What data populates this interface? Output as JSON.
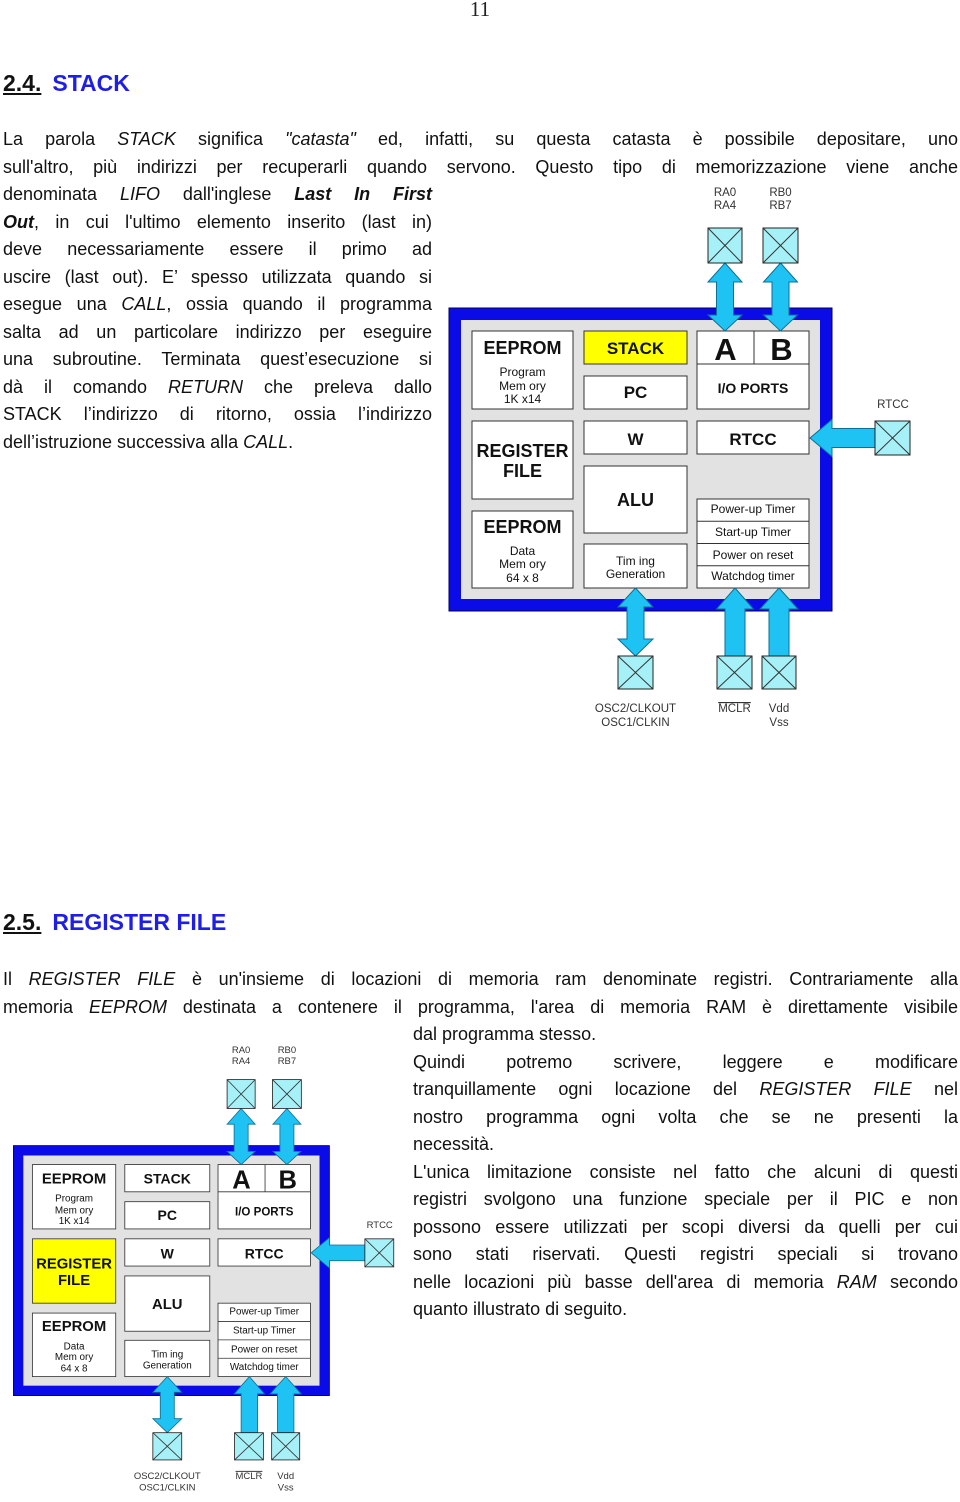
{
  "page_number": "11",
  "colors": {
    "heading_blue": "#1e1ee6",
    "chip_border": "#0b0be8",
    "chip_inner": "#e2e2e2",
    "arrow": "#1ec3f4",
    "pin_fill": "#a6f1f7",
    "highlight": "#ffff00"
  },
  "section_2_4": {
    "number": "2.4.",
    "title": "STACK",
    "lines": [
      {
        "runs": [
          {
            "t": "La parola "
          },
          {
            "t": "STACK",
            "s": "i"
          },
          {
            "t": " significa "
          },
          {
            "t": "\"catasta\"",
            "s": "i"
          },
          {
            "t": " ed, infatti, su questa catasta è possibile depositare,   uno"
          }
        ]
      },
      {
        "runs": [
          {
            "t": "sull'altro, più   indirizzi per recuperarli quando servono. Questo tipo di memorizzazione viene anche"
          }
        ]
      },
      {
        "runs": [
          {
            "t": "denominata "
          },
          {
            "t": "LIFO",
            "s": "i"
          },
          {
            "t": " dall'inglese "
          },
          {
            "t": "Last In First",
            "s": "bi"
          }
        ]
      },
      {
        "runs": [
          {
            "t": "Out",
            "s": "bi"
          },
          {
            "t": ", in cui l'ultimo elemento inserito (last in)"
          }
        ]
      },
      {
        "runs": [
          {
            "t": "deve necessariamente essere il primo ad"
          }
        ]
      },
      {
        "runs": [
          {
            "t": "uscire (last out). E’ spesso utilizzata quando si"
          }
        ]
      },
      {
        "runs": [
          {
            "t": "esegue una "
          },
          {
            "t": "CALL",
            "s": "i"
          },
          {
            "t": ", ossia quando il programma"
          }
        ]
      },
      {
        "runs": [
          {
            "t": "salta ad un particolare indirizzo per eseguire"
          }
        ]
      },
      {
        "runs": [
          {
            "t": "una subroutine. Terminata quest’esecuzione si"
          }
        ]
      },
      {
        "runs": [
          {
            "t": "dà il comando "
          },
          {
            "t": "RETURN",
            "s": "i"
          },
          {
            "t": " che preleva dallo"
          }
        ]
      },
      {
        "runs": [
          {
            "t": "STACK l’indirizzo di ritorno, ossia l’indirizzo"
          }
        ]
      },
      {
        "runs": [
          {
            "t": "dell’istruzione successiva alla "
          },
          {
            "t": "CALL",
            "s": "i"
          },
          {
            "t": "."
          }
        ]
      }
    ]
  },
  "section_2_5": {
    "number": "2.5.",
    "title": "REGISTER FILE",
    "lines": [
      {
        "runs": [
          {
            "t": "Il "
          },
          {
            "t": "REGISTER FILE",
            "s": "i"
          },
          {
            "t": " è un'insieme di locazioni di memoria ram denominate registri. Contrariamente alla"
          }
        ]
      },
      {
        "runs": [
          {
            "t": "memoria "
          },
          {
            "t": "EEPROM",
            "s": "i"
          },
          {
            "t": " destinata a contenere il programma, l'area di memoria RAM è direttamente visibile"
          }
        ]
      },
      {
        "runs": [
          {
            "t": "dal programma stesso."
          }
        ]
      },
      {
        "runs": [
          {
            "t": "Quindi potremo scrivere, leggere e modificare"
          }
        ]
      },
      {
        "runs": [
          {
            "t": "tranquillamente ogni locazione del "
          },
          {
            "t": "REGISTER FILE",
            "s": "i"
          },
          {
            "t": " nel"
          }
        ]
      },
      {
        "runs": [
          {
            "t": "nostro programma ogni volta che se ne presenti la"
          }
        ]
      },
      {
        "runs": [
          {
            "t": "necessità."
          }
        ]
      },
      {
        "runs": [
          {
            "t": "L'unica limitazione consiste nel fatto che alcuni di questi"
          }
        ]
      },
      {
        "runs": [
          {
            "t": "registri svolgono una funzione speciale per il PIC e non"
          }
        ]
      },
      {
        "runs": [
          {
            "t": "possono essere utilizzati per scopi diversi da quelli per cui"
          }
        ]
      },
      {
        "runs": [
          {
            "t": "sono stati riservati. Questi registri speciali si trovano"
          }
        ]
      },
      {
        "runs": [
          {
            "t": "nelle locazioni più basse dell'area di memoria "
          },
          {
            "t": "RAM",
            "s": "i"
          },
          {
            "t": " secondo"
          }
        ]
      },
      {
        "runs": [
          {
            "t": "quanto illustrato di seguito."
          }
        ]
      }
    ]
  },
  "diagrams": [
    {
      "highlight": "stack",
      "blocks": {
        "eeprom_program": {
          "title": "EEPROM",
          "lines": [
            "Program",
            "Mem ory",
            "1K x14"
          ]
        },
        "stack": "STACK",
        "pc": "PC",
        "port_a": "A",
        "port_b": "B",
        "io_ports": "I/O PORTS",
        "register_file": [
          "REGISTER",
          "FILE"
        ],
        "w": "W",
        "rtcc": "RTCC",
        "alu": "ALU",
        "eeprom_data": {
          "title": "EEPROM",
          "lines": [
            "Data",
            "Mem ory",
            "64 x 8"
          ]
        },
        "timing": [
          "Tim ing",
          "Generation"
        ],
        "reset_timers": [
          "Power-up Timer",
          "Start-up Timer",
          "Power on reset",
          "Watchdog timer"
        ]
      },
      "pins": {
        "port_a": [
          "RA0",
          "RA4"
        ],
        "port_b": [
          "RB0",
          "RB7"
        ],
        "rtcc": [
          "RTCC"
        ],
        "osc": [
          "OSC2/CLKOUT",
          "OSC1/CLKIN"
        ],
        "mclr": [
          "MCLR"
        ],
        "power": [
          "Vdd",
          "Vss"
        ]
      }
    },
    {
      "highlight": "register_file",
      "blocks": {
        "eeprom_program": {
          "title": "EEPROM",
          "lines": [
            "Program",
            "Mem ory",
            "1K x14"
          ]
        },
        "stack": "STACK",
        "pc": "PC",
        "port_a": "A",
        "port_b": "B",
        "io_ports": "I/O PORTS",
        "register_file": [
          "REGISTER",
          "FILE"
        ],
        "w": "W",
        "rtcc": "RTCC",
        "alu": "ALU",
        "eeprom_data": {
          "title": "EEPROM",
          "lines": [
            "Data",
            "Mem ory",
            "64 x 8"
          ]
        },
        "timing": [
          "Tim ing",
          "Generation"
        ],
        "reset_timers": [
          "Power-up Timer",
          "Start-up Timer",
          "Power on reset",
          "Watchdog timer"
        ]
      },
      "pins": {
        "port_a": [
          "RA0",
          "RA4"
        ],
        "port_b": [
          "RB0",
          "RB7"
        ],
        "rtcc": [
          "RTCC"
        ],
        "osc": [
          "OSC2/CLKOUT",
          "OSC1/CLKIN"
        ],
        "mclr": [
          "MCLR"
        ],
        "power": [
          "Vdd",
          "Vss"
        ]
      }
    }
  ]
}
